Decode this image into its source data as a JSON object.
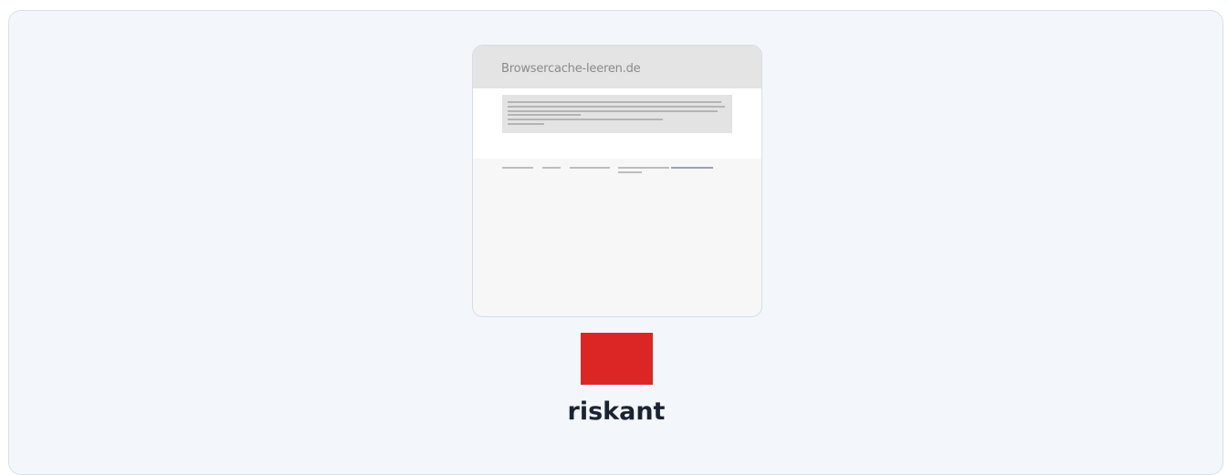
{
  "preview": {
    "site_title": "Browsercache-leeren.de"
  },
  "assessment": {
    "rating_label": "riskant",
    "rating_color": "#dc2626"
  }
}
